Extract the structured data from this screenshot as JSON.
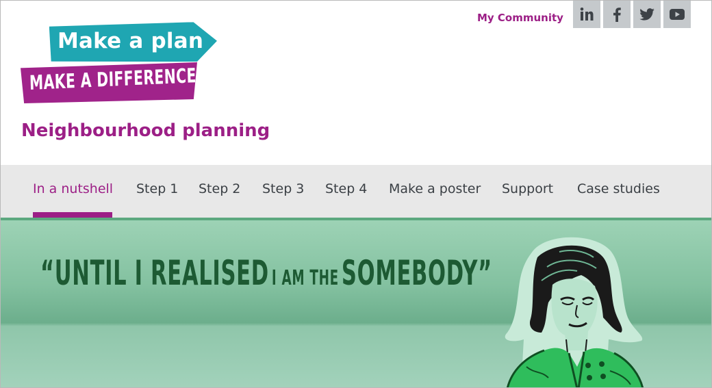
{
  "logo": {
    "line1": "Make a plan",
    "line2": "MAKE A DIFFERENCE",
    "teal": "#1fa6b2",
    "purple": "#a0238a"
  },
  "site_title": "Neighbourhood planning",
  "utility": {
    "community_link": "My Community",
    "social": [
      {
        "name": "linkedin-icon",
        "label": "in"
      },
      {
        "name": "facebook-icon",
        "label": "f"
      },
      {
        "name": "twitter-icon",
        "label": "twitter"
      },
      {
        "name": "youtube-icon",
        "label": "youtube"
      }
    ]
  },
  "nav": {
    "items": [
      {
        "label": "In a nutshell",
        "active": true
      },
      {
        "label": "Step 1",
        "active": false
      },
      {
        "label": "Step 2",
        "active": false
      },
      {
        "label": "Step 3",
        "active": false
      },
      {
        "label": "Step 4",
        "active": false
      },
      {
        "label": "Make a poster",
        "active": false
      },
      {
        "label": "Support",
        "active": false
      },
      {
        "label": "Case studies",
        "active": false
      }
    ]
  },
  "hero": {
    "quote_open": "“UNTIL I REALISED",
    "quote_mid": "I AM THE",
    "quote_end": "SOMEBODY”"
  },
  "colors": {
    "accent": "#9c1f86",
    "nav_bg": "#e8e8e8",
    "social_bg": "#c5c9cc",
    "hero_green": "#83c1a0",
    "quote_text": "#1d5a33"
  }
}
